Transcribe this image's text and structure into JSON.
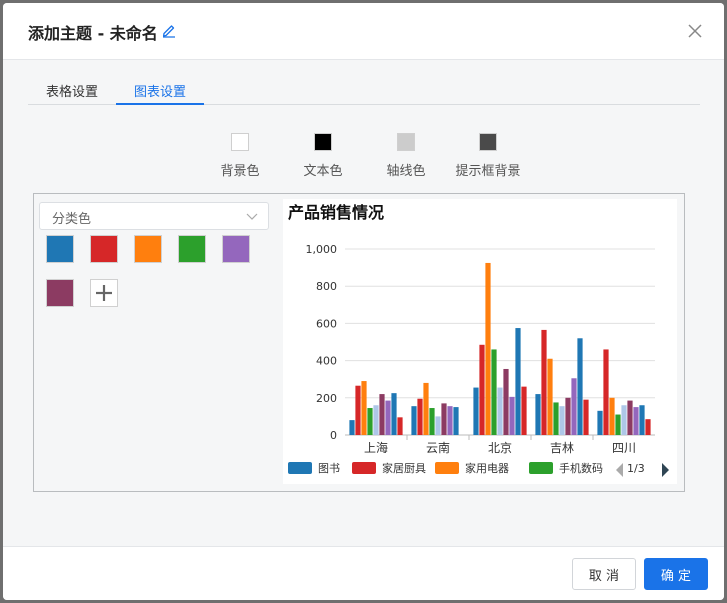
{
  "dialog": {
    "title": "添加主题 - 未命名"
  },
  "tabs": [
    {
      "label": "表格设置",
      "active": false
    },
    {
      "label": "图表设置",
      "active": true
    }
  ],
  "theme_colors": [
    {
      "label": "背景色",
      "color": "#ffffff"
    },
    {
      "label": "文本色",
      "color": "#000000"
    },
    {
      "label": "轴线色",
      "color": "#cccccc"
    },
    {
      "label": "提示框背景",
      "color": "#4a4a4a"
    }
  ],
  "palette": {
    "mode": "分类色",
    "colors": [
      "#1f77b4",
      "#d62728",
      "#ff7f0e",
      "#2ca02c",
      "#9467bd",
      "#8c3b62"
    ]
  },
  "chart_data": {
    "type": "bar",
    "title": "产品销售情况",
    "categories": [
      "上海",
      "云南",
      "北京",
      "吉林",
      "四川"
    ],
    "ylim": [
      0,
      1000
    ],
    "y_ticks": [
      "1,000",
      "800",
      "600",
      "400",
      "200",
      "0"
    ],
    "grid": true,
    "legend_position": "bottom",
    "legend_page": "1/3",
    "series": [
      {
        "name": "图书",
        "color": "#1f77b4",
        "values": [
          80,
          155,
          255,
          220,
          130
        ]
      },
      {
        "name": "家居厨具",
        "color": "#d62728",
        "values": [
          265,
          195,
          485,
          565,
          460
        ]
      },
      {
        "name": "家用电器",
        "color": "#ff7f0e",
        "values": [
          290,
          280,
          925,
          410,
          200
        ]
      },
      {
        "name": "手机数码",
        "color": "#2ca02c",
        "values": [
          145,
          145,
          460,
          175,
          110
        ]
      },
      {
        "color": "#aec7e8",
        "values": [
          160,
          100,
          255,
          155,
          160
        ]
      },
      {
        "color": "#8c3b62",
        "values": [
          220,
          170,
          355,
          200,
          185
        ]
      },
      {
        "color": "#9467bd",
        "values": [
          185,
          155,
          205,
          305,
          150
        ]
      },
      {
        "color": "#1f77b4",
        "values": [
          225,
          150,
          575,
          520,
          160
        ]
      },
      {
        "color": "#d62728",
        "values": [
          95,
          0,
          260,
          190,
          85
        ]
      }
    ]
  },
  "footer": {
    "cancel_label": "取 消",
    "ok_label": "确 定"
  }
}
